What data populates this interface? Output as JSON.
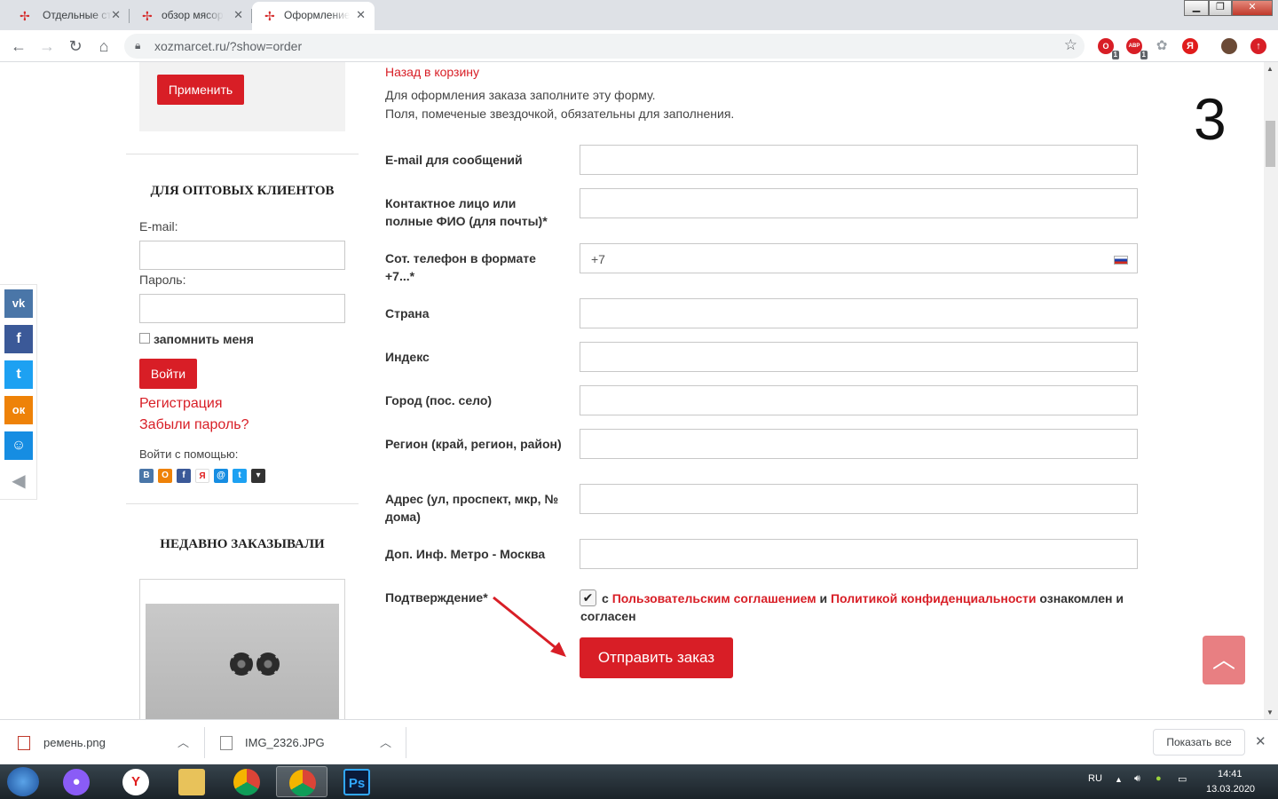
{
  "browser": {
    "tabs": [
      {
        "label": "Отдельные ст",
        "active": false
      },
      {
        "label": "обзор мясор",
        "active": false
      },
      {
        "label": "Оформление",
        "active": true
      }
    ],
    "url": "xozmarcet.ru/?show=order",
    "extensions": [
      {
        "name": "opera-ext-icon",
        "color": "#d81e26",
        "label": "O",
        "count": "1"
      },
      {
        "name": "adblock-icon",
        "color": "#d81e26",
        "label": "ABP",
        "count": "1"
      },
      {
        "name": "paw-icon",
        "color": "#9aa0a6",
        "label": "",
        "count": ""
      },
      {
        "name": "yandex-icon",
        "color": "#e01c1c",
        "label": "Я",
        "count": ""
      },
      {
        "name": "profile-avatar",
        "color": "#6b4a36",
        "label": "",
        "count": ""
      },
      {
        "name": "update-icon",
        "color": "#d81e26",
        "label": "↑",
        "count": ""
      }
    ]
  },
  "sidebar": {
    "apply_button": "Применить",
    "wholesale_title": "ДЛЯ ОПТОВЫХ КЛИЕНТОВ",
    "email_label": "E-mail:",
    "password_label": "Пароль:",
    "remember_label": "запомнить меня",
    "login_button": "Войти",
    "register_link": "Регистрация",
    "forgot_link": "Забыли пароль?",
    "login_with_label": "Войти с помощью:",
    "login_providers": [
      {
        "name": "vk-icon",
        "glyph": "В",
        "color": "#4a76a8"
      },
      {
        "name": "odnoklassniki-icon",
        "glyph": "О",
        "color": "#ee8208"
      },
      {
        "name": "facebook-icon",
        "glyph": "f",
        "color": "#3b5998"
      },
      {
        "name": "yandex-icon",
        "glyph": "Я",
        "color": "#ffffff"
      },
      {
        "name": "mailru-icon",
        "glyph": "@",
        "color": "#168de2"
      },
      {
        "name": "twitter-icon",
        "glyph": "t",
        "color": "#1da1f2"
      },
      {
        "name": "more-icon",
        "glyph": "▾",
        "color": "#333333"
      }
    ],
    "recent_title": "НЕДАВНО ЗАКАЗЫВАЛИ"
  },
  "share": [
    {
      "name": "vk-share-icon",
      "glyph": "vk",
      "color": "#4a76a8"
    },
    {
      "name": "facebook-share-icon",
      "glyph": "f",
      "color": "#3b5998"
    },
    {
      "name": "twitter-share-icon",
      "glyph": "t",
      "color": "#1da1f2"
    },
    {
      "name": "odnoklassniki-share-icon",
      "glyph": "ок",
      "color": "#ee8208"
    },
    {
      "name": "moymir-share-icon",
      "glyph": "м",
      "color": "#168de2"
    }
  ],
  "form": {
    "back_link": "Назад в корзину",
    "intro_line1": "Для оформления заказа заполните эту форму.",
    "intro_line2": "Поля, помеченые звездочкой, обязательны для заполнения.",
    "step_number": "3",
    "fields": [
      {
        "label": "E-mail для сообщений",
        "value": ""
      },
      {
        "label": "Контактное лицо или полные ФИО (для почты)*",
        "value": ""
      },
      {
        "label": "Сот. телефон в формате +7...*",
        "value": "+7"
      },
      {
        "label": "Страна",
        "value": ""
      },
      {
        "label": "Индекс",
        "value": ""
      },
      {
        "label": "Город (пос. село)",
        "value": ""
      },
      {
        "label": "Регион (край, регион, район)",
        "value": ""
      },
      {
        "label": "Адрес (ул, проспект, мкр, № дома)",
        "value": ""
      },
      {
        "label": "Доп. Инф. Метро - Москва",
        "value": ""
      }
    ],
    "confirm_label": "Подтверждение*",
    "consent_prefix": "с",
    "consent_link1": "Пользовательским соглашением",
    "consent_and": "и",
    "consent_link2": "Политикой конфиденциальности",
    "consent_suffix": "ознакомлен и согласен",
    "consent_checked": true,
    "submit_button": "Отправить заказ"
  },
  "downloads": {
    "items": [
      {
        "name": "ремень.png"
      },
      {
        "name": "IMG_2326.JPG"
      }
    ],
    "show_all": "Показать все"
  },
  "taskbar": {
    "lang": "RU",
    "time": "14:41",
    "date": "13.03.2020"
  }
}
